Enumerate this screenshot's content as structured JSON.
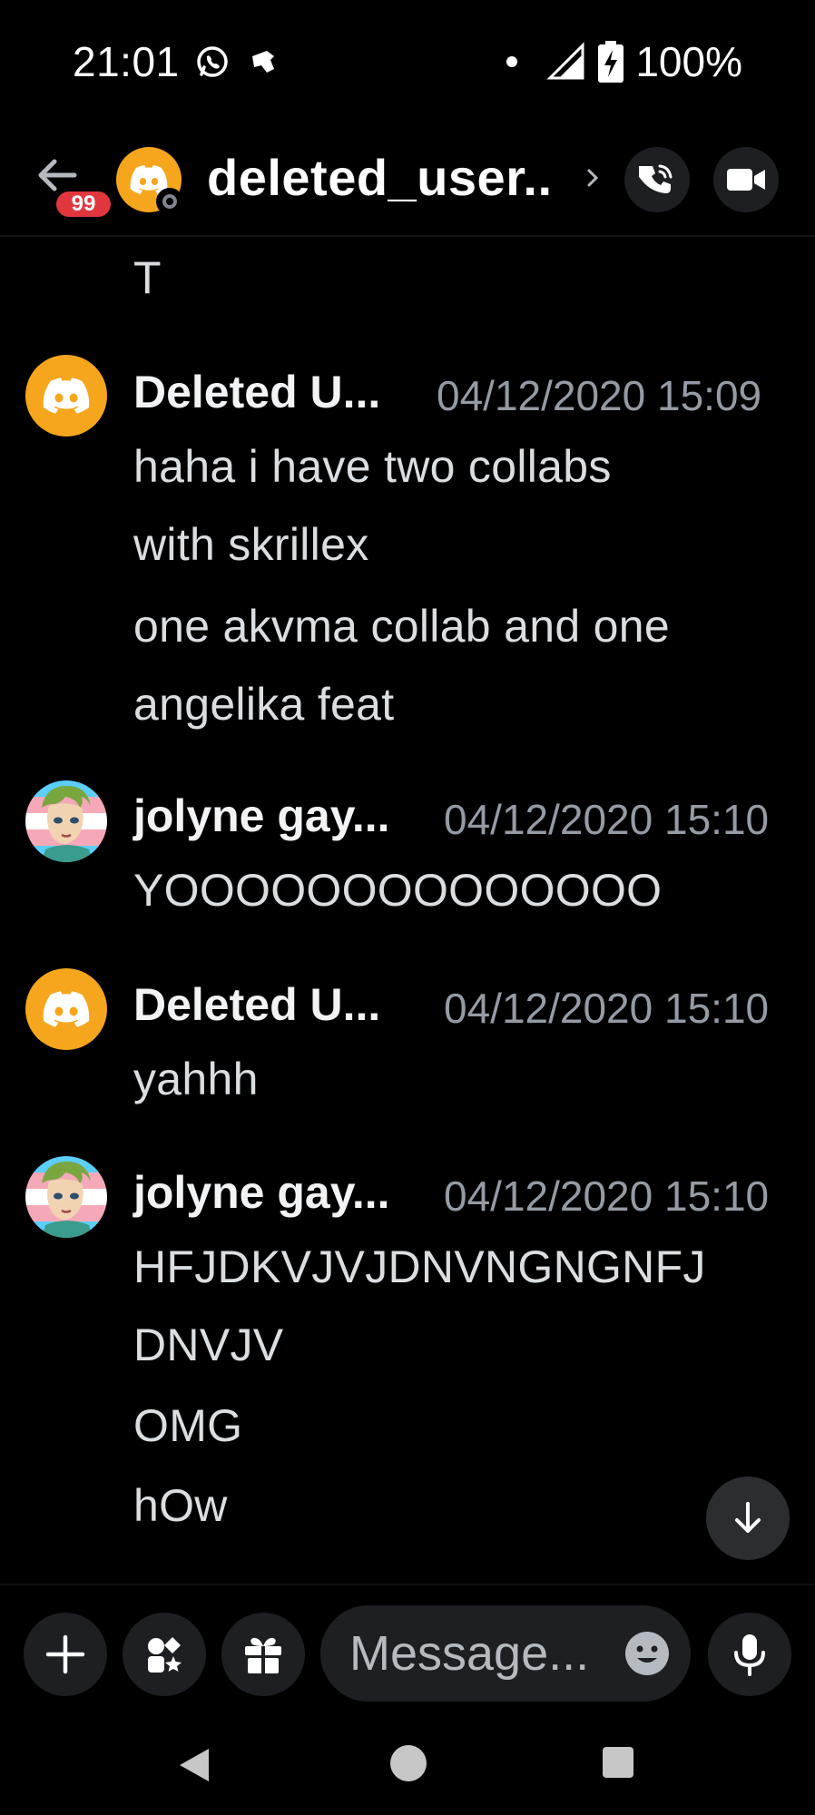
{
  "status_bar": {
    "time": "21:01",
    "icons": [
      "whatsapp-icon",
      "notification-icon"
    ],
    "battery": "100%"
  },
  "header": {
    "unread_count": "99",
    "title": "deleted_user..",
    "actions": [
      "phone-icon",
      "video-camera-icon"
    ]
  },
  "messages": {
    "continued_text": "T",
    "groups": [
      {
        "author": "Deleted U...",
        "timestamp": "04/12/2020 15:09",
        "avatar": "discord-logo",
        "lines": [
          "haha i have two collabs",
          "with skrillex",
          "one akvma collab and one",
          "angelika feat"
        ]
      },
      {
        "author": "jolyne gay...",
        "timestamp": "04/12/2020 15:10",
        "avatar": "jolyne-avatar",
        "lines": [
          "YOOOOOOOOOOOOOO"
        ]
      },
      {
        "author": "Deleted U...",
        "timestamp": "04/12/2020 15:10",
        "avatar": "discord-logo",
        "lines": [
          "yahhh"
        ]
      },
      {
        "author": "jolyne gay...",
        "timestamp": "04/12/2020 15:10",
        "avatar": "jolyne-avatar",
        "lines": [
          "HFJDKVJVJDNVNGNGNFJ",
          "DNVJV",
          "OMG",
          "hOw"
        ]
      }
    ]
  },
  "composer": {
    "placeholder": "Message..."
  },
  "colors": {
    "background": "#000000",
    "discord_avatar": "#f6a61c",
    "badge_red": "#e2363e",
    "button_bg": "#1e1f22",
    "timestamp": "#949ba4"
  }
}
